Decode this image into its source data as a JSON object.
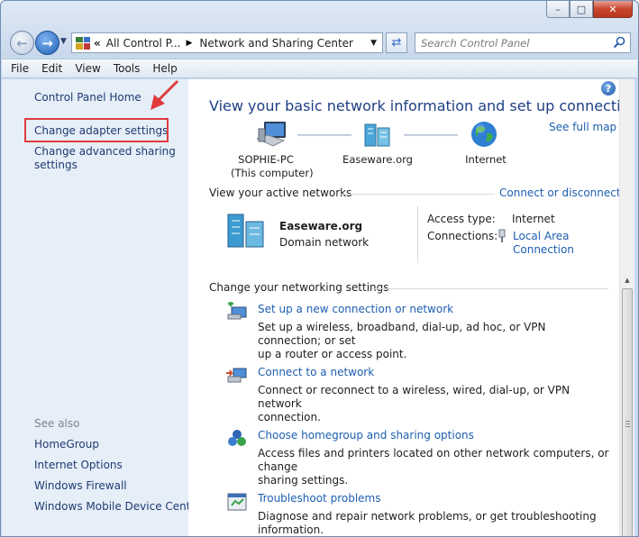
{
  "window": {
    "caption": {
      "minimize": "–",
      "maximize": "□",
      "close": "✕"
    }
  },
  "address": {
    "overflow": "«",
    "crumbs": [
      "All Control P...",
      "Network and Sharing Center"
    ],
    "separator": "▶"
  },
  "search": {
    "placeholder": "Search Control Panel"
  },
  "menu": [
    "File",
    "Edit",
    "View",
    "Tools",
    "Help"
  ],
  "left_pane": {
    "home": "Control Panel Home",
    "links": [
      "Change adapter settings",
      "Change advanced sharing",
      "settings"
    ],
    "see_also_heading": "See also",
    "see_also": [
      "HomeGroup",
      "Internet Options",
      "Windows Firewall",
      "Windows Mobile Device Center"
    ]
  },
  "main": {
    "title": "View your basic network information and set up connections",
    "see_full_map": "See full map",
    "nodes": [
      {
        "name": "SOPHIE-PC",
        "sub": "(This computer)"
      },
      {
        "name": "Easeware.org",
        "sub": ""
      },
      {
        "name": "Internet",
        "sub": ""
      }
    ],
    "active_networks": {
      "heading": "View your active networks",
      "action": "Connect or disconnect",
      "network_name": "Easeware.org",
      "network_type": "Domain network",
      "access_type_label": "Access type:",
      "access_type_value": "Internet",
      "connections_label": "Connections:",
      "connection_line1": "Local Area",
      "connection_line2": "Connection"
    },
    "settings": {
      "heading": "Change your networking settings",
      "tasks": [
        {
          "title": "Set up a new connection or network",
          "desc1": "Set up a wireless, broadband, dial-up, ad hoc, or VPN connection; or set",
          "desc2": "up a router or access point."
        },
        {
          "title": "Connect to a network",
          "desc1": "Connect or reconnect to a wireless, wired, dial-up, or VPN network",
          "desc2": "connection."
        },
        {
          "title": "Choose homegroup and sharing options",
          "desc1": "Access files and printers located on other network computers, or change",
          "desc2": "sharing settings."
        },
        {
          "title": "Troubleshoot problems",
          "desc1": "Diagnose and repair network problems, or get troubleshooting",
          "desc2": "information."
        }
      ]
    }
  },
  "help_icon": "?",
  "colors": {
    "link": "#1c5fb0",
    "title": "#1e3f86",
    "highlight": "#e03c3c",
    "leftpane": "#e6eef8"
  }
}
